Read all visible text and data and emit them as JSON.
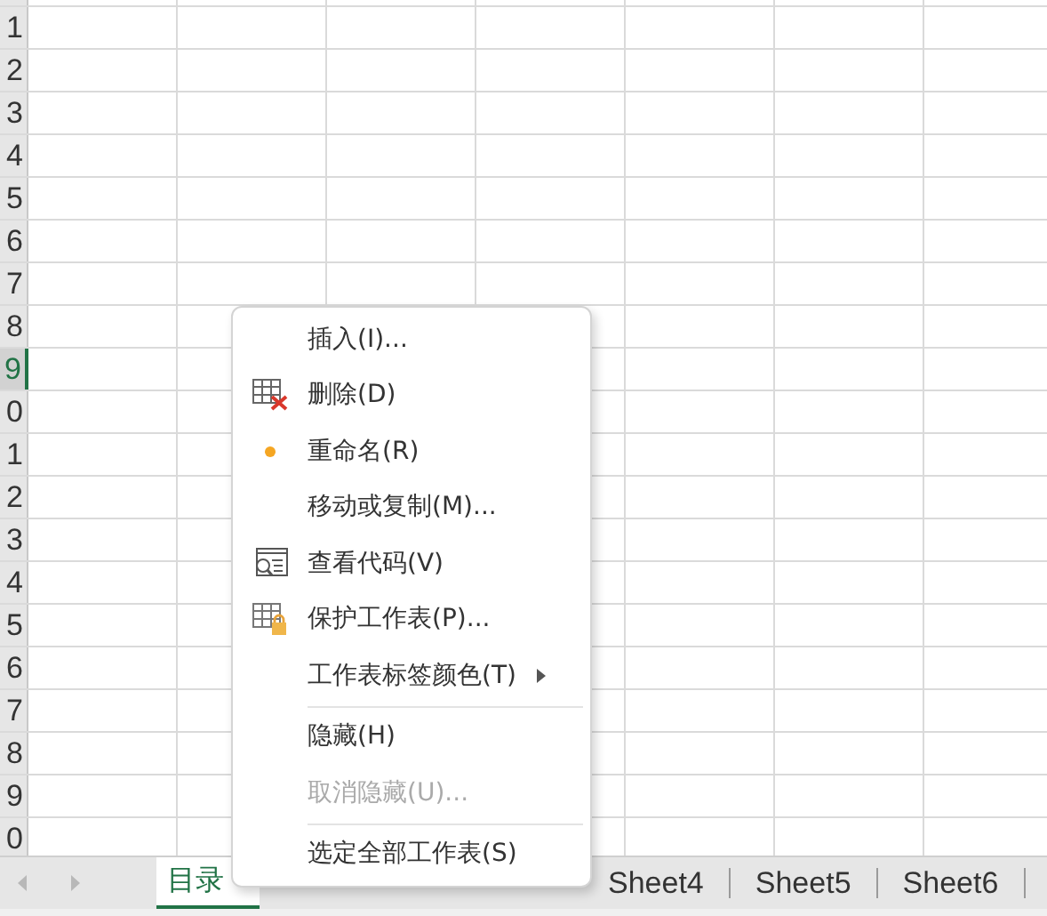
{
  "row_headers": [
    {
      "label": "1",
      "selected": false
    },
    {
      "label": "2",
      "selected": false
    },
    {
      "label": "3",
      "selected": false
    },
    {
      "label": "4",
      "selected": false
    },
    {
      "label": "5",
      "selected": false
    },
    {
      "label": "6",
      "selected": false
    },
    {
      "label": "7",
      "selected": false
    },
    {
      "label": "8",
      "selected": false
    },
    {
      "label": "9",
      "selected": true
    },
    {
      "label": "0",
      "selected": false
    },
    {
      "label": "1",
      "selected": false
    },
    {
      "label": "2",
      "selected": false
    },
    {
      "label": "3",
      "selected": false
    },
    {
      "label": "4",
      "selected": false
    },
    {
      "label": "5",
      "selected": false
    },
    {
      "label": "6",
      "selected": false
    },
    {
      "label": "7",
      "selected": false
    },
    {
      "label": "8",
      "selected": false
    },
    {
      "label": "9",
      "selected": false
    },
    {
      "label": "0",
      "selected": false
    }
  ],
  "sheet_tabs": [
    {
      "label": "目录",
      "selected": true
    },
    {
      "label": "Sheet4",
      "selected": false
    },
    {
      "label": "Sheet5",
      "selected": false
    },
    {
      "label": "Sheet6",
      "selected": false
    }
  ],
  "context_menu": {
    "groups": [
      [
        {
          "label": "插入(I)...",
          "kind": "plain",
          "disabled": false,
          "submenu": false
        },
        {
          "label": "删除(D)",
          "kind": "delete",
          "disabled": false,
          "submenu": false
        },
        {
          "label": "重命名(R)",
          "kind": "dot",
          "disabled": false,
          "submenu": false
        },
        {
          "label": "移动或复制(M)...",
          "kind": "plain",
          "disabled": false,
          "submenu": false
        },
        {
          "label": "查看代码(V)",
          "kind": "code",
          "disabled": false,
          "submenu": false
        },
        {
          "label": "保护工作表(P)...",
          "kind": "protect",
          "disabled": false,
          "submenu": false
        },
        {
          "label": "工作表标签颜色(T)",
          "kind": "plain",
          "disabled": false,
          "submenu": true
        }
      ],
      [
        {
          "label": "隐藏(H)",
          "kind": "plain",
          "disabled": false,
          "submenu": false
        },
        {
          "label": "取消隐藏(U)...",
          "kind": "plain",
          "disabled": true,
          "submenu": false
        }
      ],
      [
        {
          "label": "选定全部工作表(S)",
          "kind": "plain",
          "disabled": false,
          "submenu": false
        }
      ]
    ]
  }
}
